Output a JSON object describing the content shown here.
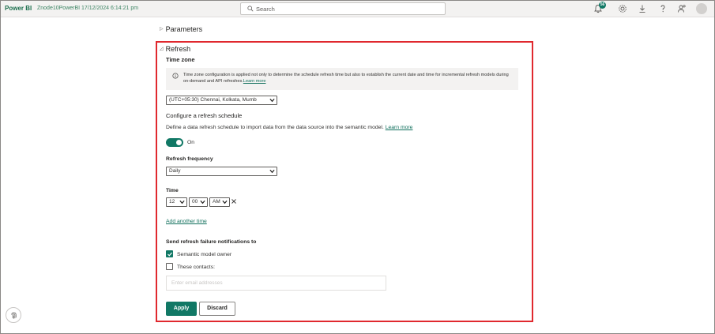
{
  "topbar": {
    "brand": "Power BI",
    "workspace": "Znode10PowerBI 17/12/2024 6:14:21 pm",
    "search_placeholder": "Search",
    "notification_count": "56"
  },
  "params": {
    "title": "Parameters"
  },
  "refresh": {
    "title": "Refresh",
    "timezone_label": "Time zone",
    "info_text": "Time zone configuration is applied not only to determine the schedule refresh time but also to establish the current date and time for incremental refresh models during on-demand and API refreshes.",
    "info_link": "Learn more",
    "timezone_value": "(UTC+05:30) Chennai, Kolkata, Mumb",
    "schedule_label": "Configure a refresh schedule",
    "schedule_desc": "Define a data refresh schedule to import data from the data source into the semantic model.",
    "schedule_link": "Learn more",
    "toggle_label": "On",
    "frequency_label": "Refresh frequency",
    "frequency_value": "Daily",
    "time_label": "Time",
    "hour": "12",
    "minute": "00",
    "ampm": "AM",
    "add_time": "Add another time",
    "notify_label": "Send refresh failure notifications to",
    "owner_label": "Semantic model owner",
    "contacts_label": "These contacts:",
    "email_placeholder": "Enter email addresses",
    "apply": "Apply",
    "discard": "Discard"
  },
  "colors": {
    "accent": "#117865",
    "highlight": "#e0282e",
    "brand": "#1c6f4d"
  }
}
